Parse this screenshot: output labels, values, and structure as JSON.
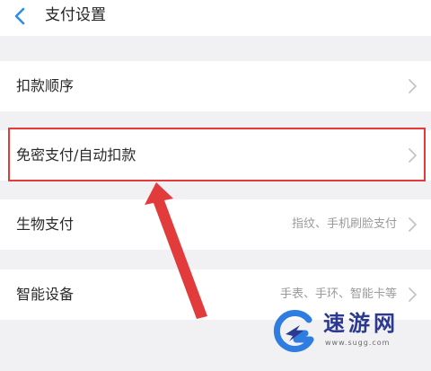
{
  "header": {
    "title": "支付设置",
    "back_icon": "chevron-left-icon",
    "accent_color": "#2f8cf0"
  },
  "rows": [
    {
      "label": "扣款顺序",
      "value": ""
    },
    {
      "label": "免密支付/自动扣款",
      "value": ""
    },
    {
      "label": "生物支付",
      "value": "指纹、手机刷脸支付"
    },
    {
      "label": "智能设备",
      "value": "手表、手环、智能卡等"
    }
  ],
  "annotation": {
    "highlight_color": "#e23b3b",
    "highlight_target": "免密支付/自动扣款"
  },
  "watermark": {
    "name": "速游网",
    "url": "www.sugg.com"
  }
}
